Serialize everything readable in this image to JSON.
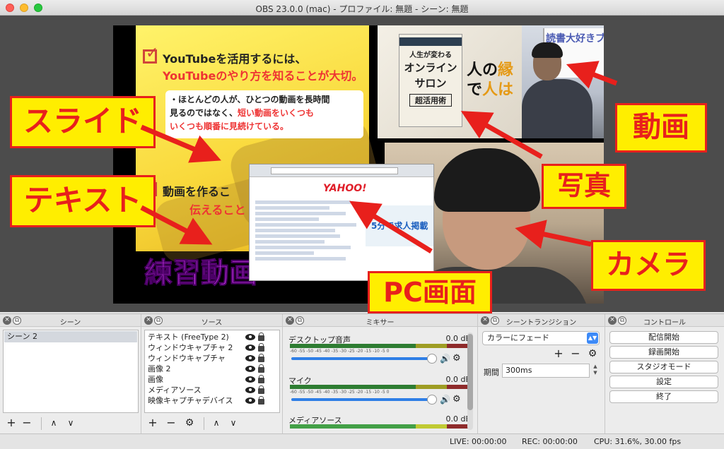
{
  "window": {
    "title": "OBS 23.0.0 (mac) - プロファイル: 無題 - シーン: 無題"
  },
  "preview": {
    "slide": {
      "heading_line1": "YouTubeを活用するには、",
      "heading_line2": "YouTubeのやり方を知ることが大切。",
      "bullet_line1": "・ほとんどの人が、ひとつの動画を長時間",
      "bullet_line2a": "見るのではなく、",
      "bullet_line2b": "短い動画をいくつも",
      "bullet_line3a": "いくつも順番に見続けている。",
      "sub_heading": "動画を作るこ",
      "sub_line": "伝えること"
    },
    "practice_text": "練習動画",
    "book": {
      "line1": "人生が変わる",
      "line2": "オンライン",
      "line3": "サロン",
      "line4": "超活用術"
    },
    "photo_calligraphy": [
      "人の",
      "縁",
      "で",
      "人は"
    ],
    "video_whiteboard": "読書大好きブロガー",
    "pc_screen_logo": "YAHOO!",
    "pc_ad_text": "5分で求人掲載"
  },
  "labels": {
    "slide": "スライド",
    "text": "テキスト",
    "video": "動画",
    "photo": "写真",
    "camera": "カメラ",
    "pc": "PC画面"
  },
  "docks": {
    "scenes": {
      "title": "シーン",
      "items": [
        "シーン 2"
      ]
    },
    "sources": {
      "title": "ソース",
      "items": [
        "テキスト (FreeType 2)",
        "ウィンドウキャプチャ 2",
        "ウィンドウキャプチャ",
        "画像 2",
        "画像",
        "メディアソース",
        "映像キャプチャデバイス"
      ]
    },
    "mixer": {
      "title": "ミキサー",
      "scale": "-60  -55  -50  -45  -40  -35  -30  -25  -20  -15  -10  -5  0",
      "channels": [
        {
          "name": "デスクトップ音声",
          "db": "0.0 dB"
        },
        {
          "name": "マイク",
          "db": "0.0 dB"
        },
        {
          "name": "メディアソース",
          "db": "0.0 dB"
        }
      ]
    },
    "transitions": {
      "title": "シーントランジション",
      "selected": "カラーにフェード",
      "duration_label": "期間",
      "duration_value": "300ms"
    },
    "controls": {
      "title": "コントロール",
      "buttons": [
        "配信開始",
        "録画開始",
        "スタジオモード",
        "設定",
        "終了"
      ]
    }
  },
  "status": {
    "live": "LIVE: 00:00:00",
    "rec": "REC: 00:00:00",
    "cpu": "CPU: 31.6%, 30.00 fps"
  },
  "colors": {
    "label_fill": "#ffee00",
    "label_text": "#e8201c",
    "arrow": "#e8201c",
    "accent": "#2f7fe6"
  }
}
